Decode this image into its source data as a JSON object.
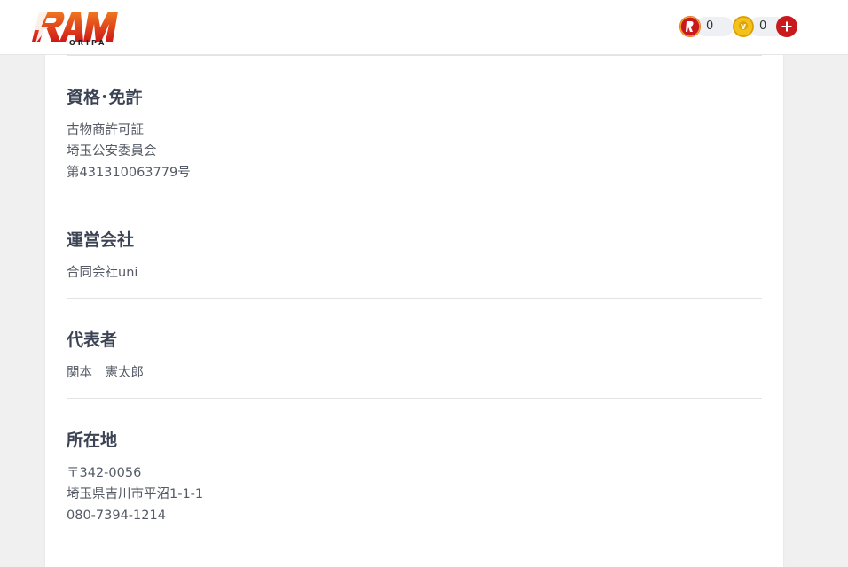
{
  "header": {
    "logo_text": "RAM",
    "logo_sub": "ORIPA",
    "red_points": "0",
    "gold_points": "0",
    "icons": {
      "red_coin": "red-coin-icon",
      "gold_coin": "gold-coin-icon",
      "add": "plus-icon"
    },
    "colors": {
      "brand_red": "#c8191e",
      "gold": "#f2c11a"
    }
  },
  "sections": [
    {
      "title": "資格･免許",
      "lines": [
        "古物商許可証",
        "埼玉公安委員会",
        "第431310063779号"
      ]
    },
    {
      "title": "運営会社",
      "lines": [
        "合同会社uni"
      ]
    },
    {
      "title": "代表者",
      "lines": [
        "関本　憲太郎"
      ]
    },
    {
      "title": "所在地",
      "lines": [
        "〒342-0056",
        "埼玉県吉川市平沼1-1-1",
        "080-7394-1214"
      ]
    }
  ]
}
